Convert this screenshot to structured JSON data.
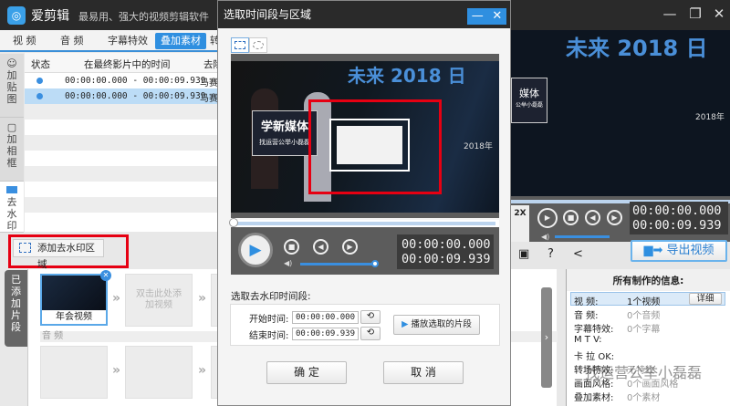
{
  "app": {
    "logo": "film-reel-icon",
    "name": "爱剪辑",
    "tagline": "最易用、强大的视频剪辑软件"
  },
  "window": {
    "minimize": "—",
    "restore": "❐",
    "close": "✕"
  },
  "tabs": [
    {
      "label": "视  频"
    },
    {
      "label": "音  频"
    },
    {
      "label": "字幕特效"
    },
    {
      "label": "叠加素材",
      "active": true
    },
    {
      "label": "转"
    }
  ],
  "side_tabs": [
    {
      "label": "加贴图",
      "icon": "sticker-icon"
    },
    {
      "label": "加相框",
      "icon": "frame-icon"
    },
    {
      "label": "去水印",
      "icon": "watermark-icon",
      "active": true
    }
  ],
  "table": {
    "headers": [
      "状态",
      "在最终影片中的时间",
      "去除"
    ],
    "rows": [
      {
        "time": "00:00:00.000 - 00:00:09.939",
        "method": "马赛克"
      },
      {
        "time": "00:00:00.000 - 00:00:09.939",
        "method": "马赛克",
        "selected": true
      }
    ]
  },
  "add_watermark_button": "添加去水印区域",
  "added_clips": {
    "tab": "已添加片段",
    "clip_label": "年会视频",
    "placeholder": "双击此处添加视频",
    "audio_label": "音 频"
  },
  "dialog": {
    "title": "选取时间段与区域",
    "shape_tools": [
      "rectangle-select-icon",
      "ellipse-select-icon"
    ],
    "video_text": {
      "banner": "未来 2018 日",
      "sign_main": "学新媒体",
      "sign_sub": "找运营公举小磊磊",
      "date": "2018年"
    },
    "seek_progress": 0,
    "volume": 1.0,
    "time_current": "00:00:00.000",
    "time_total": "00:00:09.939",
    "section_label": "选取去水印时间段:",
    "start_label": "开始时间:",
    "start_value": "00:00:00.000",
    "end_label": "结束时间:",
    "end_value": "00:00:09.939",
    "play_selection": "播放选取的片段",
    "ok": "确 定",
    "cancel": "取 消"
  },
  "preview": {
    "banner": "未来 2018 日",
    "sign": "媒体",
    "sign_sub": "公举小磊磊",
    "date": "2018年",
    "speed": "2X",
    "time_current": "00:00:00.000",
    "time_total": "00:00:09.939",
    "volume": 1.0,
    "export": "导出视频"
  },
  "info": {
    "title": "所有制作的信息:",
    "detail_button": "详细",
    "rows": [
      {
        "k": "视    频:",
        "v": "1个视频"
      },
      {
        "k": "音    频:",
        "v": "0个音频"
      },
      {
        "k": "字幕特效:",
        "v": "0个字幕"
      },
      {
        "k": "M   T   V:",
        "v": ""
      },
      {
        "k": "卡  拉  OK:",
        "v": ""
      },
      {
        "k": "转场特效:",
        "v": "无特效"
      },
      {
        "k": "画面风格:",
        "v": "0个画面风格"
      },
      {
        "k": "叠加素材:",
        "v": "0个素材"
      }
    ]
  },
  "watermark_overlay": "找运营公举小磊磊",
  "colors": {
    "accent": "#2f8fe0",
    "highlight": "#e60012",
    "titlebar": "#2a2a2a"
  }
}
